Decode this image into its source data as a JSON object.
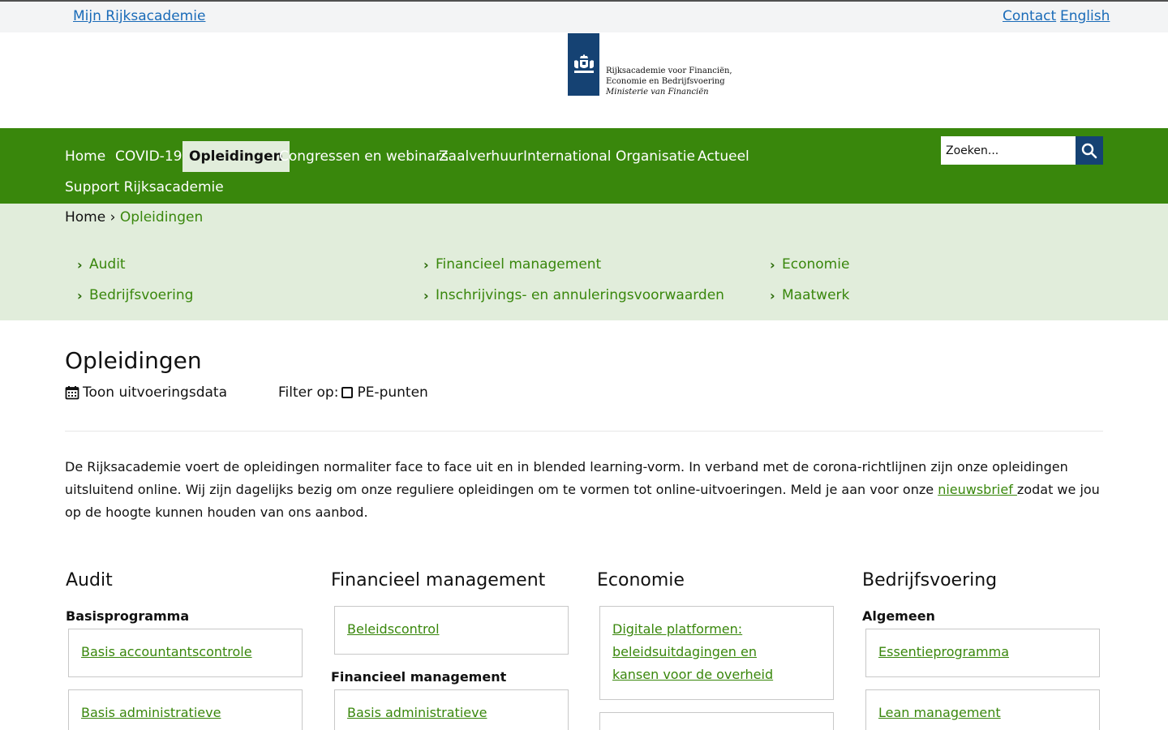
{
  "topbar": {
    "mijn": "Mijn Rijksacademie",
    "contact": "Contact",
    "english": "English"
  },
  "logo": {
    "line1": "Rijksacademie voor Financiën,",
    "line2": "Economie en Bedrijfsvoering",
    "line3": "Ministerie van Financiën",
    "brand_color": "#154273",
    "icon": "coat-of-arms-icon"
  },
  "nav": {
    "items": [
      "Home",
      "COVID-19",
      "Opleidingen",
      "Congressen en webinars",
      "Zaalverhuur",
      "International",
      "Organisatie",
      "Actueel",
      "Support Rijksacademie"
    ],
    "active": "Opleidingen",
    "search_placeholder": "Zoeken...",
    "search_icon": "search-icon",
    "color": "#39870c"
  },
  "breadcrumb": {
    "home": "Home",
    "sep": "›",
    "current": "Opleidingen"
  },
  "subnav": [
    "Audit",
    "Financieel management",
    "Economie",
    "Bedrijfsvoering",
    "Inschrijvings- en annuleringsvoorwaarden",
    "Maatwerk"
  ],
  "main": {
    "title": "Opleidingen",
    "toggle_label": "Toon uitvoeringsdata",
    "filter_label": "Filter op:",
    "filter_option": "PE-punten",
    "intro_before": "De Rijksacademie voert de opleidingen normaliter face to face uit en in blended learning-vorm. In verband met de corona-richtlijnen zijn onze opleidingen uitsluitend online. Wij zijn dagelijks bezig om onze reguliere opleidingen om te vormen tot online-uitvoeringen. Meld je aan voor onze ",
    "intro_link": "nieuwsbrief ",
    "intro_after": "zodat we jou op de hoogte kunnen houden van ons aanbod."
  },
  "columns": [
    {
      "title": "Audit",
      "groups": [
        {
          "heading": "Basisprogramma",
          "courses": [
            "Basis accountantscontrole",
            "Basis administratieve organisatie"
          ]
        }
      ]
    },
    {
      "title": "Financieel management",
      "groups": [
        {
          "heading": "",
          "courses": [
            "Beleidscontrol"
          ]
        },
        {
          "heading": "Financieel management",
          "courses": [
            "Basis administratieve organisatie"
          ]
        }
      ]
    },
    {
      "title": "Economie",
      "groups": [
        {
          "heading": "",
          "courses": [
            "Digitale platformen: beleidsuitdagingen en kansen voor de overheid",
            ""
          ]
        }
      ]
    },
    {
      "title": "Bedrijfsvoering",
      "groups": [
        {
          "heading": "Algemeen",
          "courses": [
            "Essentieprogramma",
            "Lean management Rijksoverheid"
          ]
        }
      ]
    }
  ]
}
